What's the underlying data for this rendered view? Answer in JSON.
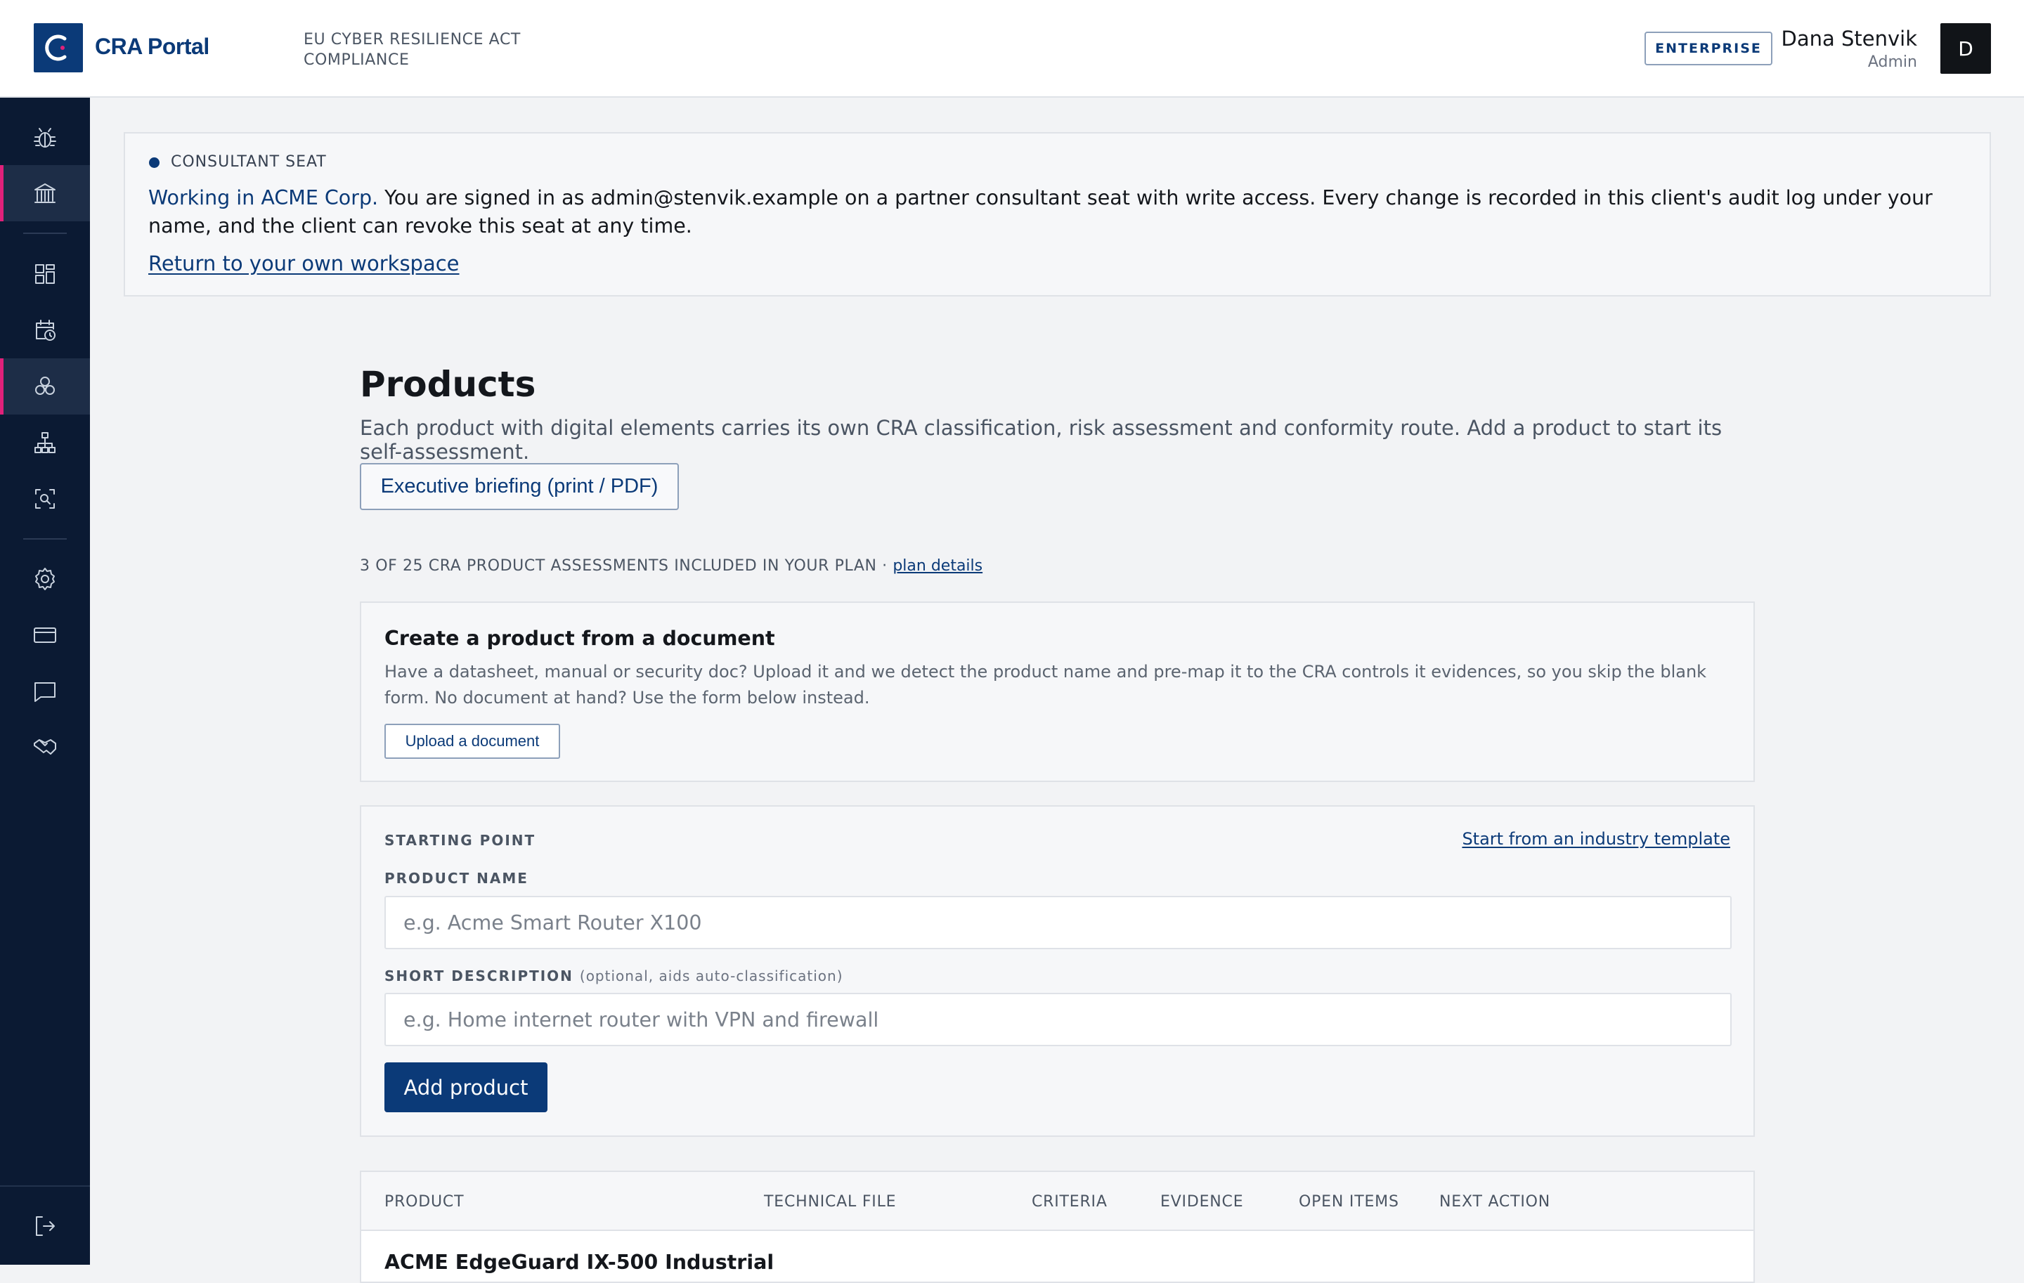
{
  "header": {
    "brand": "CRA Portal",
    "tagline": "EU CYBER RESILIENCE ACT COMPLIANCE",
    "plan_badge": "ENTERPRISE",
    "user_name": "Dana Stenvik",
    "user_role": "Admin",
    "avatar_initial": "D"
  },
  "sidebar": {
    "items": [
      {
        "icon": "bug-icon",
        "active": false
      },
      {
        "icon": "bank-icon",
        "active": true
      },
      {
        "icon": "dashboard-icon",
        "active": false
      },
      {
        "icon": "calendar-clock-icon",
        "active": false
      },
      {
        "icon": "products-icon",
        "active": true
      },
      {
        "icon": "hierarchy-icon",
        "active": false
      },
      {
        "icon": "scan-search-icon",
        "active": false
      },
      {
        "icon": "gear-icon",
        "active": false
      },
      {
        "icon": "credit-card-icon",
        "active": false
      },
      {
        "icon": "chat-icon",
        "active": false
      },
      {
        "icon": "handshake-icon",
        "active": false
      },
      {
        "icon": "logout-icon",
        "active": false
      }
    ]
  },
  "banner": {
    "label": "CONSULTANT SEAT",
    "client_text": "Working in ACME Corp.",
    "message": " You are signed in as admin@stenvik.example on a partner consultant seat with write access. Every change is recorded in this client's audit log under your name, and the client can revoke this seat at any time.",
    "return_link": "Return to your own workspace"
  },
  "main": {
    "title": "Products",
    "description": "Each product with digital elements carries its own CRA classification, risk assessment and conformity route. Add a product to start its self-assessment.",
    "briefing_button": "Executive briefing (print / PDF)",
    "plan_text": "3 OF 25 CRA PRODUCT ASSESSMENTS INCLUDED IN YOUR PLAN · ",
    "plan_link": "plan details"
  },
  "doc_card": {
    "title": "Create a product from a document",
    "text": "Have a datasheet, manual or security doc? Upload it and we detect the product name and pre-map it to the CRA controls it evidences, so you skip the blank form. No document at hand? Use the form below instead.",
    "upload_button": "Upload a document"
  },
  "form": {
    "starting_point_label": "STARTING POINT",
    "template_link": "Start from an industry template",
    "product_name_label": "PRODUCT NAME",
    "product_name_placeholder": "e.g. Acme Smart Router X100",
    "product_name_value": "",
    "description_label": "SHORT DESCRIPTION",
    "description_optional": "(optional, aids auto-classification)",
    "description_placeholder": "e.g. Home internet router with VPN and firewall",
    "description_value": "",
    "add_button": "Add product"
  },
  "table": {
    "columns": [
      "PRODUCT",
      "TECHNICAL FILE",
      "CRITERIA",
      "EVIDENCE",
      "OPEN ITEMS",
      "NEXT ACTION"
    ],
    "rows": [
      {
        "product": "ACME EdgeGuard IX-500 Industrial"
      }
    ]
  },
  "colors": {
    "brand": "#0b3a78",
    "sidebar_bg": "#0b1a33",
    "active_accent": "#e0217a"
  }
}
